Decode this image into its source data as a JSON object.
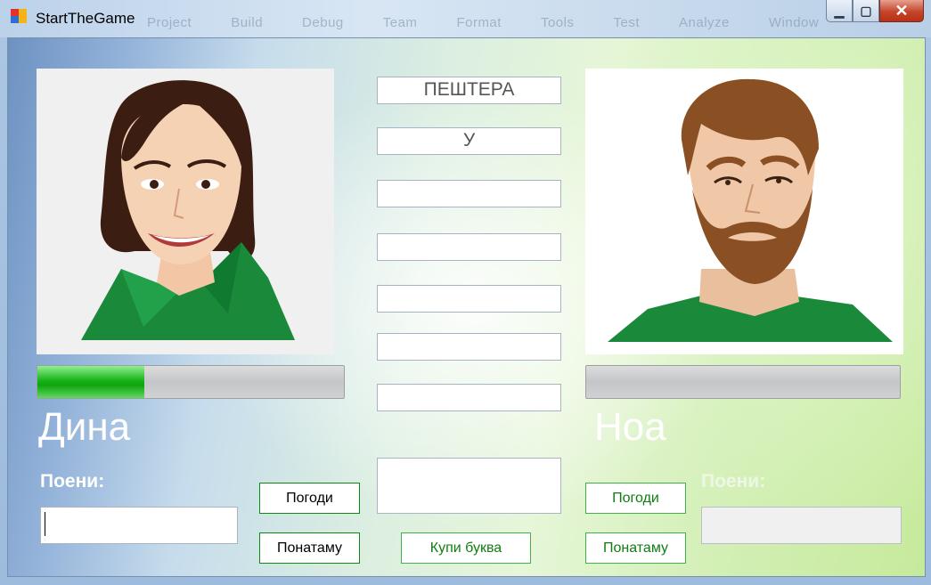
{
  "window": {
    "title": "StartTheGame",
    "background_menu": [
      "Project",
      "Build",
      "Debug",
      "Team",
      "Format",
      "Tools",
      "Test",
      "Analyze",
      "Window"
    ],
    "controls": {
      "minimize": "▁",
      "maximize": "▢",
      "close": "✕"
    }
  },
  "player1": {
    "name": "Дина",
    "points_label": "Поени:",
    "points_value": "",
    "progress": 0.35,
    "guess_button": "Погоди",
    "later_button": "Понатаму",
    "avatar": "female-avatar"
  },
  "player2": {
    "name": "Ноа",
    "points_label": "Поени:",
    "points_value": "",
    "progress": 0.0,
    "guess_button": "Погоди",
    "later_button": "Понатаму",
    "avatar": "male-avatar"
  },
  "center": {
    "word_boxes": [
      "ПЕШТЕРА",
      "У",
      "",
      "",
      "",
      "",
      ""
    ],
    "answer_value": "",
    "buy_letter_button": "Купи буква"
  },
  "colors": {
    "accent_green": "#0e8a12",
    "progress_green": "#19b219",
    "shirt_green": "#1a8a3a"
  }
}
